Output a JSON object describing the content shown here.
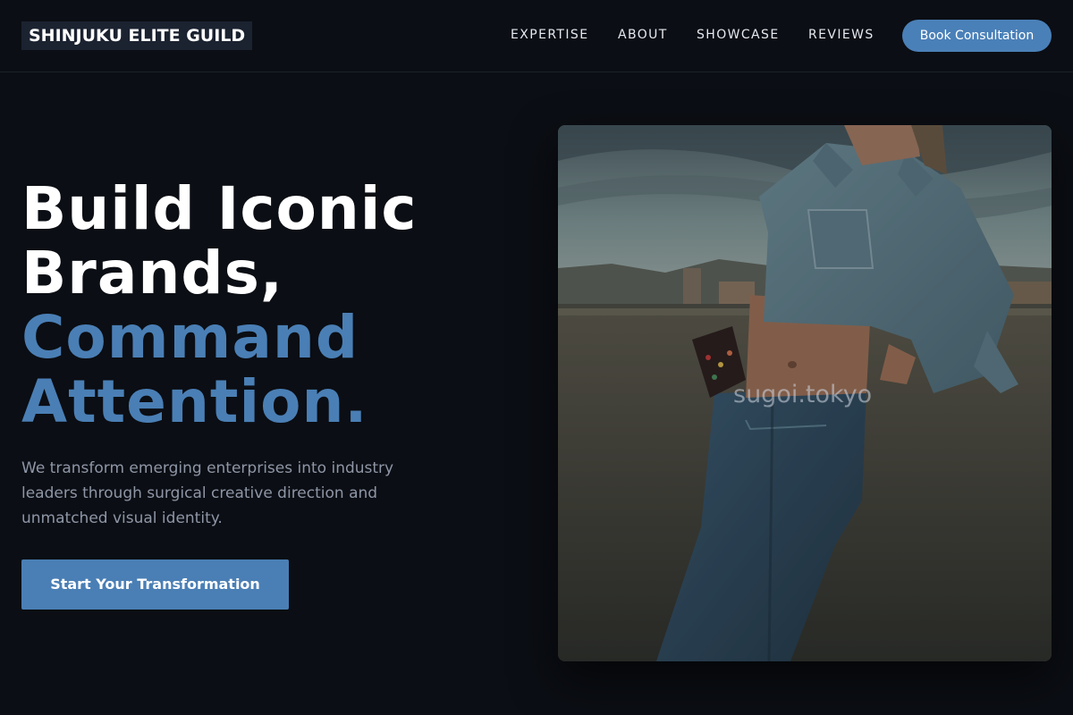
{
  "brand": {
    "name": "SHINJUKU ELITE GUILD"
  },
  "nav": {
    "links": [
      "EXPERTISE",
      "ABOUT",
      "SHOWCASE",
      "REVIEWS"
    ],
    "cta": "Book Consultation"
  },
  "hero": {
    "title_lines": [
      "Build Iconic",
      "Brands,"
    ],
    "accent_lines": [
      "Command",
      "Attention."
    ],
    "subtitle": "We transform emerging enterprises into industry leaders through surgical creative direction and unmatched visual identity.",
    "button": "Start Your Transformation"
  },
  "image": {
    "watermark": "sugoi.tokyo"
  },
  "colors": {
    "background": "#0b0e14",
    "accent": "#4a7fb5",
    "text_muted": "#8e96a6"
  }
}
